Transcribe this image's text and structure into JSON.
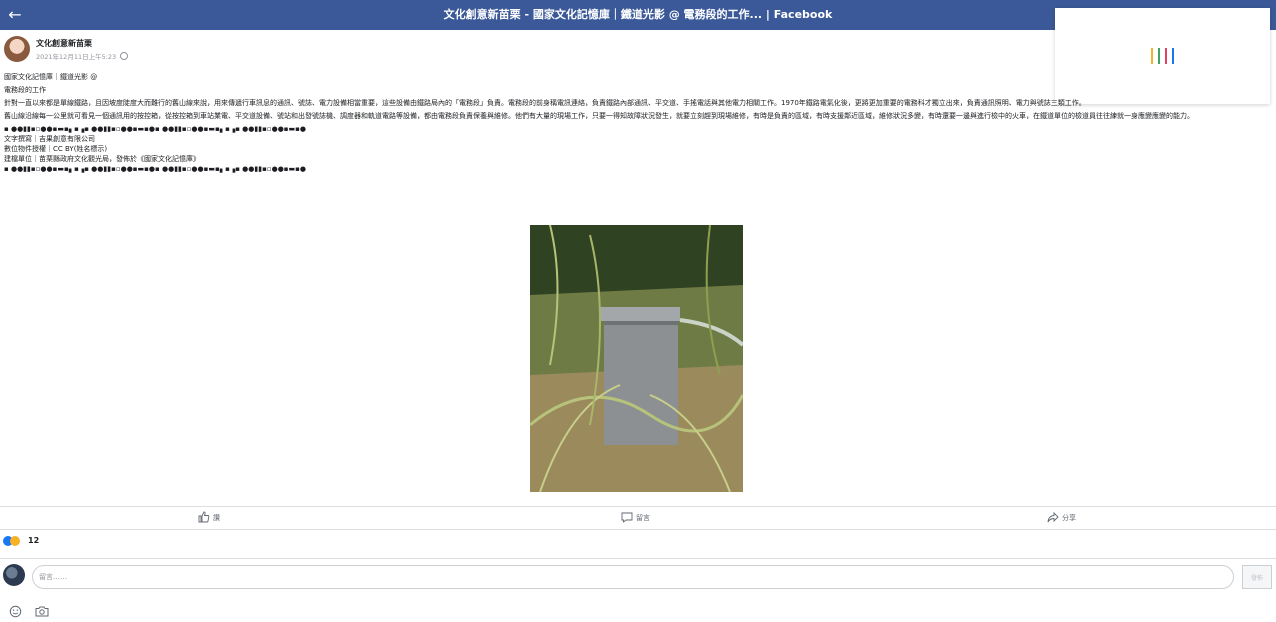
{
  "window": {
    "title": "文化創意新苗栗 - 國家文化記憶庫｜鐵道光影 @ 電務段的工作... | Facebook",
    "back_icon": "arrow-left-icon"
  },
  "colors": {
    "header_bg": "#3b5998",
    "accent": "#1877f2",
    "loader": [
      "#f7b125",
      "#3ba55c",
      "#e4405f",
      "#1877f2"
    ]
  },
  "post": {
    "author": "文化創意新苗栗",
    "timestamp": "2021年12月11日上午5:23",
    "lines": [
      "國家文化記憶庫｜鐵道光影 @",
      "電務段的工作"
    ],
    "paragraphs": [
      "針對一直以來都是單線鐵路，且因坡度陡度大而難行的舊山線來說，用來傳遞行車訊息的通訊、號誌、電力設備相當重要，這些設備由鐵路局內的「電務段」負責。電務段的前身稱電訊連絡，負責鐵路內部通訊、平交道、手搖電話與其他電力相關工作。1970年鐵路電氣化後，更將更加重要的電務科才獨立出來，負責通訊照明、電力與號誌三類工作。",
      "舊山線沿線每一公里就可看見一個通訊用的按控箱，從按控箱到車站業電、平交道設備、號站和出發號誌機、調度器和軌道電路等設備，都由電務段負責保養與維修。他們有大量的現場工作，只要一得知故障狀況發生，就要立刻趕到現場維修，有時是負責的區域，有時支援鄰近區域，維修狀況多變，有時還要一邊與進行檢中的火車，在鐵道單位的檢道員往往練就一身應變應變的能力。"
    ],
    "divider_1": "▪ ●●▮▮▪▫●●▪▬▪▖▪▗▪ ●●▮▮▪▫●●▪▬▪●▪ ●●▮▮▪▫●●▪▬▪▖▪▗▪ ●●▮▮▪▫●●▪▬▪●",
    "credits": [
      "文字撰寫｜吉果創意有限公司",
      "數位物件授權｜CC BY(姓名標示)",
      "建檔單位｜苗栗縣政府文化觀光局，發佈於《國家文化記憶庫》"
    ],
    "divider_2": "▪ ●●▮▮▪▫●●▪▬▪▖▪▗▪ ●●▮▮▪▫●●▪▬▪●▪ ●●▮▮▪▫●●▪▬▪▖▪▗▪ ●●▮▮▪▫●●▪▬▪●"
  },
  "actions": {
    "like": "讚",
    "comment": "留言",
    "share": "分享"
  },
  "reactions": {
    "icons": [
      "like-icon",
      "wow-icon"
    ],
    "count": "12"
  },
  "composer": {
    "placeholder": "留言……",
    "post_label": "發佈",
    "tools": [
      "emoji-icon",
      "camera-icon"
    ]
  }
}
